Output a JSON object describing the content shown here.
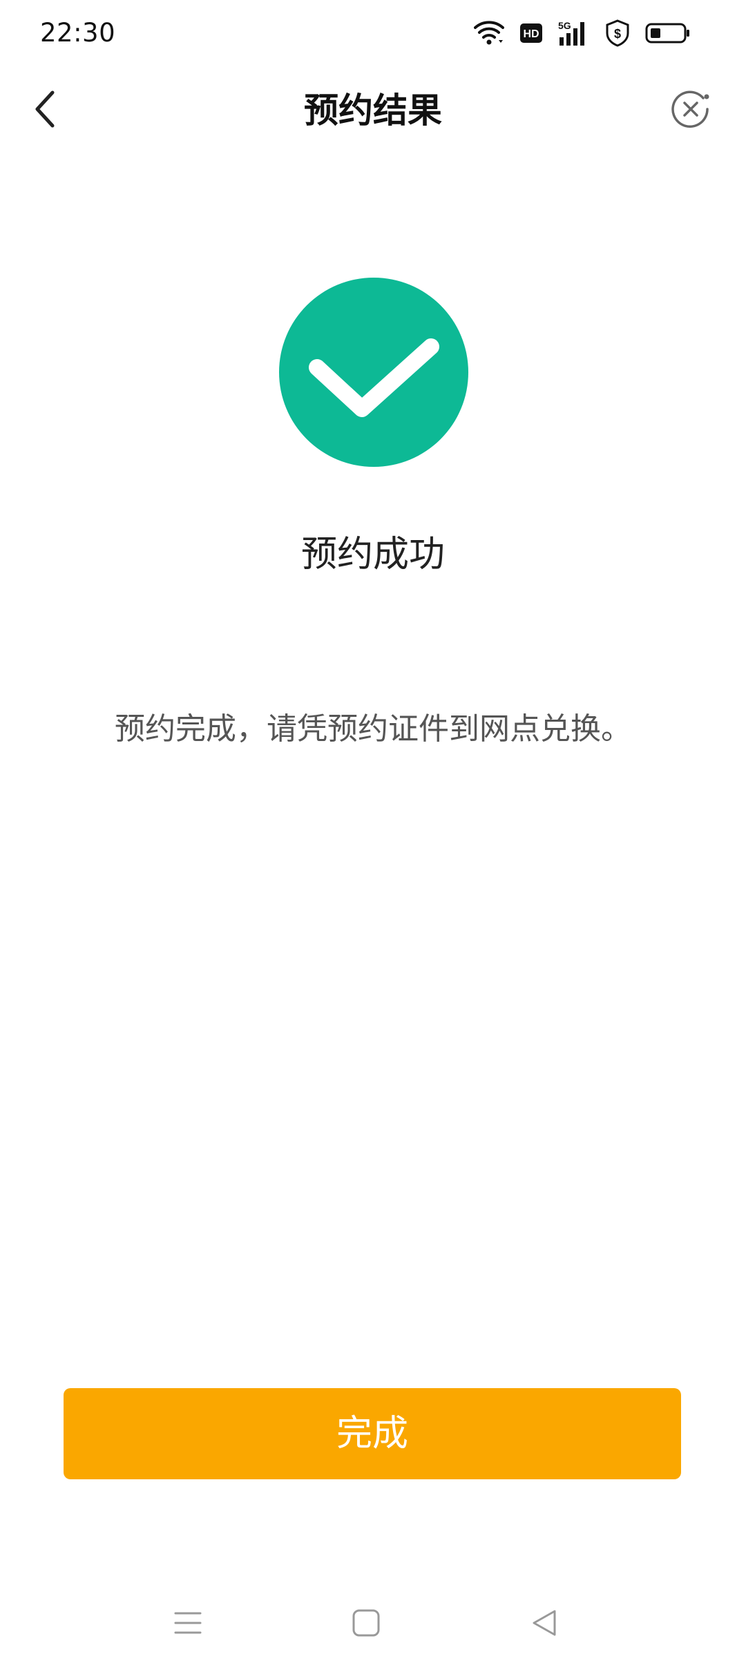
{
  "status_bar": {
    "time": "22:30",
    "network_label": "5G",
    "hd_label": "HD",
    "icons": [
      "wifi-icon",
      "hd-icon",
      "signal-5g-icon",
      "shield-dollar-icon",
      "battery-icon"
    ]
  },
  "header": {
    "title": "预约结果",
    "back_icon": "chevron-left-icon",
    "close_icon": "close-circle-icon"
  },
  "result": {
    "icon": "check-circle-icon",
    "title": "预约成功",
    "message": "预约完成，请凭预约证件到网点兑换。"
  },
  "done_button": {
    "label": "完成"
  },
  "nav_bar": {
    "icons": [
      "menu-icon",
      "home-icon",
      "back-triangle-icon"
    ]
  },
  "colors": {
    "success": "#0DB995",
    "button": "#FAA700",
    "text_primary": "#111111",
    "text_secondary": "#555555"
  }
}
